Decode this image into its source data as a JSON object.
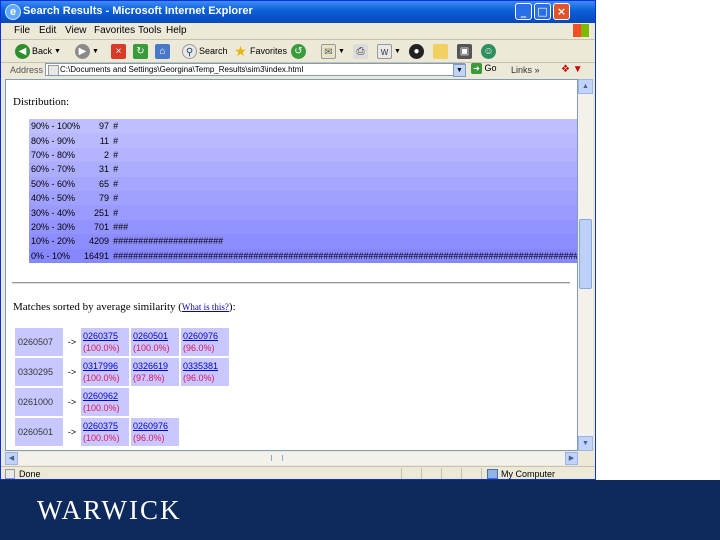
{
  "window": {
    "title": "Search Results - Microsoft Internet Explorer",
    "controls": {
      "minimize": "_",
      "maximize": "□",
      "close": "×"
    }
  },
  "menu": [
    "File",
    "Edit",
    "View",
    "Favorites",
    "Tools",
    "Help"
  ],
  "toolbar": {
    "back_label": "Back",
    "search_label": "Search",
    "favorites_label": "Favorites"
  },
  "address": {
    "label": "Address",
    "value": "C:\\Documents and Settings\\Georgina\\Temp_Results\\sim3\\index.html",
    "go_label": "Go",
    "links_label": "Links"
  },
  "page": {
    "distribution_heading": "Distribution:",
    "distribution": [
      {
        "range": "90% - 100%",
        "count": "97",
        "bar": "#",
        "color": "#bfbfff"
      },
      {
        "range": "80% - 90%",
        "count": "11",
        "bar": "#",
        "color": "#b9b9ff"
      },
      {
        "range": "70% - 80%",
        "count": "2",
        "bar": "#",
        "color": "#b3b3ff"
      },
      {
        "range": "60% - 70%",
        "count": "31",
        "bar": "#",
        "color": "#adadff"
      },
      {
        "range": "50% - 60%",
        "count": "65",
        "bar": "#",
        "color": "#a6a6ff"
      },
      {
        "range": "40% - 50%",
        "count": "79",
        "bar": "#",
        "color": "#a0a0ff"
      },
      {
        "range": "30% - 40%",
        "count": "251",
        "bar": "#",
        "color": "#9a9aff"
      },
      {
        "range": "20% - 30%",
        "count": "701",
        "bar": "###",
        "color": "#9393ff"
      },
      {
        "range": "10% - 20%",
        "count": "4209",
        "bar": "######################",
        "color": "#8d8dff"
      },
      {
        "range": "0% - 10%",
        "count": "16491",
        "bar": "##################################################################################################",
        "color": "#8787ff"
      }
    ],
    "matches_heading": "Matches sorted by average similarity (",
    "matches_heading_end": "):",
    "what_is_this": "What is this?",
    "arrow": "->",
    "matches": [
      {
        "source": "0260507",
        "targets": [
          {
            "id": "0260375",
            "pct": "(100.0%)"
          },
          {
            "id": "0260501",
            "pct": "(100.0%)"
          },
          {
            "id": "0260976",
            "pct": "(96.0%)"
          }
        ]
      },
      {
        "source": "0330295",
        "targets": [
          {
            "id": "0317996",
            "pct": "(100.0%)"
          },
          {
            "id": "0326619",
            "pct": "(97.8%)"
          },
          {
            "id": "0335381",
            "pct": "(96.0%)"
          }
        ]
      },
      {
        "source": "0261000",
        "targets": [
          {
            "id": "0260962",
            "pct": "(100.0%)"
          }
        ]
      },
      {
        "source": "0260501",
        "targets": [
          {
            "id": "0260375",
            "pct": "(100.0%)"
          },
          {
            "id": "0260976",
            "pct": "(96.0%)"
          }
        ]
      }
    ]
  },
  "status": {
    "left": "Done",
    "zone": "My Computer"
  },
  "footer": {
    "logo": "WARWICK"
  }
}
